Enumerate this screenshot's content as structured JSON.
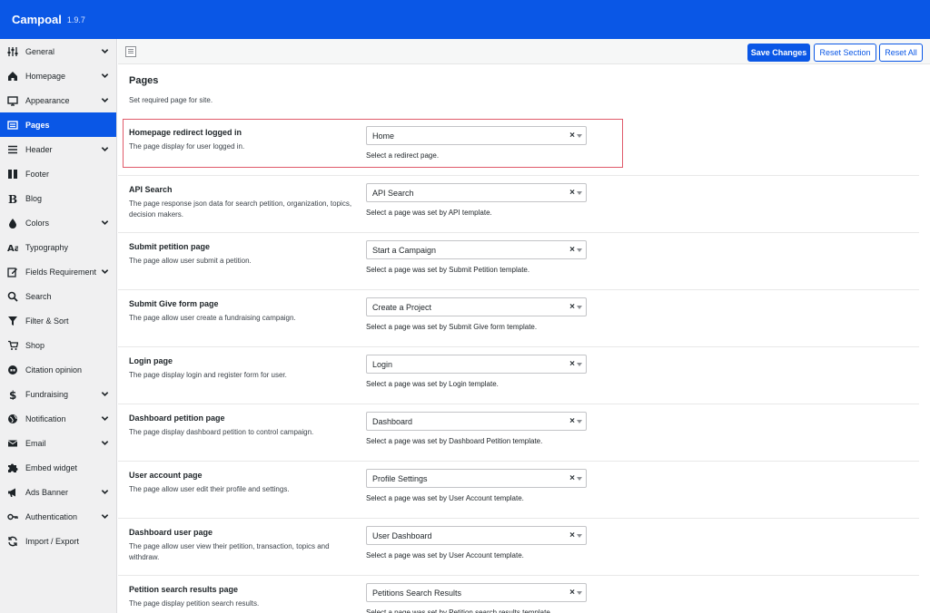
{
  "app": {
    "title": "Campoal",
    "version": "1.9.7"
  },
  "sidebar": {
    "items": [
      {
        "label": "General",
        "icon": "sliders-icon",
        "chevron": true
      },
      {
        "label": "Homepage",
        "icon": "home-icon",
        "chevron": true
      },
      {
        "label": "Appearance",
        "icon": "monitor-icon",
        "chevron": true
      },
      {
        "label": "Pages",
        "icon": "pages-icon",
        "chevron": false,
        "active": true
      },
      {
        "label": "Header",
        "icon": "menu-icon",
        "chevron": true
      },
      {
        "label": "Footer",
        "icon": "footer-icon",
        "chevron": false
      },
      {
        "label": "Blog",
        "icon": "blog-icon",
        "chevron": false
      },
      {
        "label": "Colors",
        "icon": "droplet-icon",
        "chevron": true
      },
      {
        "label": "Typography",
        "icon": "typography-icon",
        "chevron": false
      },
      {
        "label": "Fields Requirement",
        "icon": "edit-icon",
        "chevron": true
      },
      {
        "label": "Search",
        "icon": "search-icon",
        "chevron": false
      },
      {
        "label": "Filter & Sort",
        "icon": "filter-icon",
        "chevron": false
      },
      {
        "label": "Shop",
        "icon": "cart-icon",
        "chevron": false
      },
      {
        "label": "Citation opinion",
        "icon": "quote-icon",
        "chevron": false
      },
      {
        "label": "Fundraising",
        "icon": "dollar-icon",
        "chevron": true
      },
      {
        "label": "Notification",
        "icon": "globe-icon",
        "chevron": true
      },
      {
        "label": "Email",
        "icon": "email-icon",
        "chevron": true
      },
      {
        "label": "Embed widget",
        "icon": "puzzle-icon",
        "chevron": false
      },
      {
        "label": "Ads Banner",
        "icon": "megaphone-icon",
        "chevron": true
      },
      {
        "label": "Authentication",
        "icon": "key-icon",
        "chevron": true
      },
      {
        "label": "Import / Export",
        "icon": "refresh-icon",
        "chevron": false
      }
    ]
  },
  "toolbar": {
    "save": "Save Changes",
    "reset_section": "Reset Section",
    "reset_all": "Reset All"
  },
  "page": {
    "title": "Pages",
    "description": "Set required page for site."
  },
  "settings": [
    {
      "label": "Homepage redirect logged in",
      "description": "The page display for user logged in.",
      "value": "Home",
      "help": "Select a redirect page."
    },
    {
      "label": "API Search",
      "description": "The page response json data for search petition, organization, topics, decision makers.",
      "value": "API Search",
      "help": "Select a page was set by API template."
    },
    {
      "label": "Submit petition page",
      "description": "The page allow user submit a petition.",
      "value": "Start a Campaign",
      "help": "Select a page was set by Submit Petition template."
    },
    {
      "label": "Submit Give form page",
      "description": "The page allow user create a fundraising campaign.",
      "value": "Create a Project",
      "help": "Select a page was set by Submit Give form template."
    },
    {
      "label": "Login page",
      "description": "The page display login and register form for user.",
      "value": "Login",
      "help": "Select a page was set by Login template."
    },
    {
      "label": "Dashboard petition page",
      "description": "The page display dashboard petition to control campaign.",
      "value": "Dashboard",
      "help": "Select a page was set by Dashboard Petition template."
    },
    {
      "label": "User account page",
      "description": "The page allow user edit their profile and settings.",
      "value": "Profile Settings",
      "help": "Select a page was set by User Account template."
    },
    {
      "label": "Dashboard user page",
      "description": "The page allow user view their petition, transaction, topics and withdraw.",
      "value": "User Dashboard",
      "help": "Select a page was set by User Account template."
    },
    {
      "label": "Petition search results page",
      "description": "The page display petition search results.",
      "value": "Petitions Search Results",
      "help": "Select a page was set by Petition search results template."
    }
  ],
  "colors": {
    "accent": "#0a57e6",
    "highlight": "#e05a6a"
  }
}
